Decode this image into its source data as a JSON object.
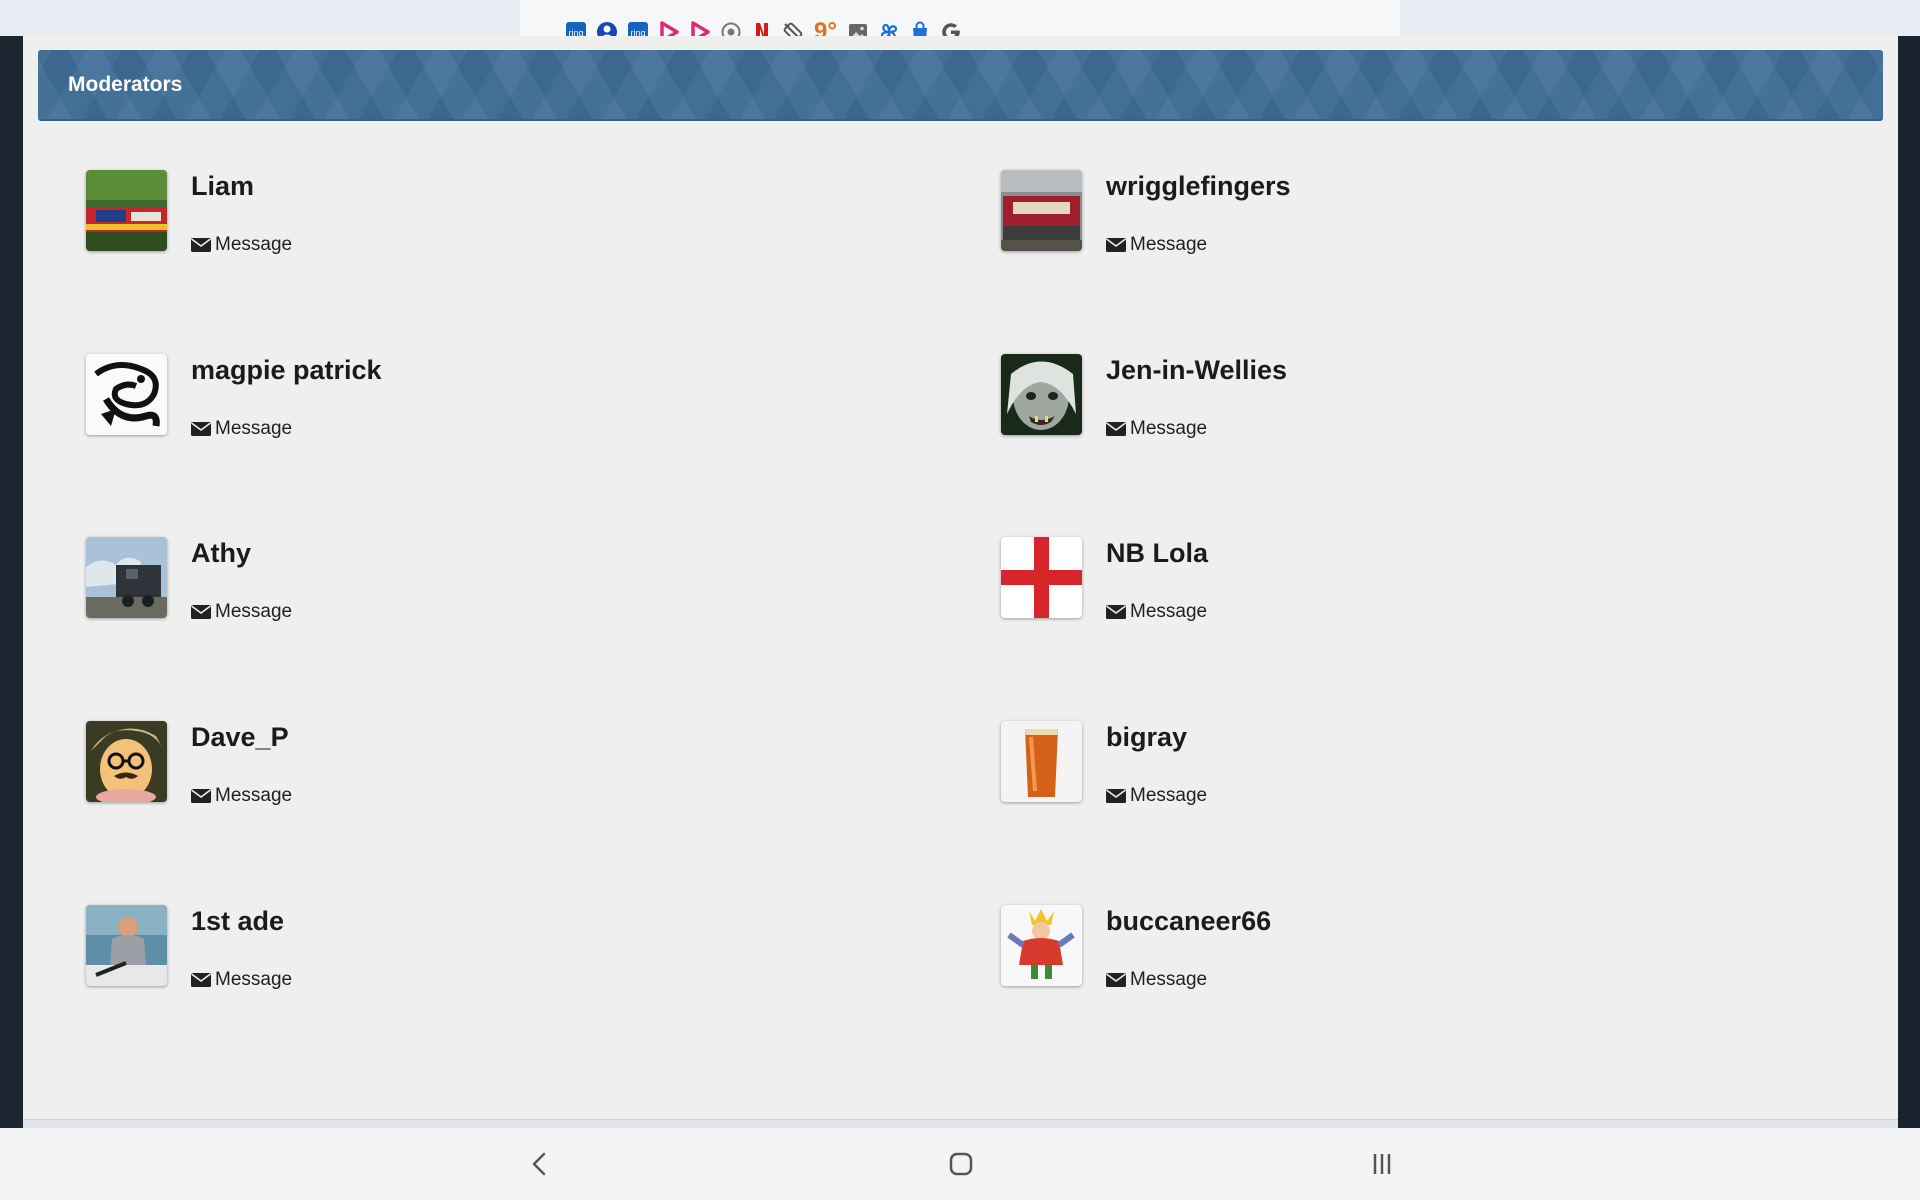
{
  "status_bar": {
    "icons": [
      "ring-icon",
      "account-icon",
      "ring-icon",
      "play-icon",
      "play-icon",
      "circle-check-icon",
      "netflix-icon",
      "rotate-icon",
      "weather-icon",
      "image-icon",
      "pinwheel-icon",
      "shopping-bag-icon",
      "google-icon"
    ],
    "temperature": "9°",
    "colors": {
      "blue": "#1565c0",
      "pink": "#e0287a",
      "red": "#d61a1a",
      "orange": "#e0701e",
      "gray": "#555555"
    }
  },
  "header": {
    "title": "Moderators",
    "color": "#3f6d97"
  },
  "members": [
    {
      "name": "Liam",
      "message_label": "Message",
      "avatar": "narrowboat-avatar"
    },
    {
      "name": "wrigglefingers",
      "message_label": "Message",
      "avatar": "boat-sign-avatar"
    },
    {
      "name": "magpie patrick",
      "message_label": "Message",
      "avatar": "magpie-drawing-avatar"
    },
    {
      "name": "Jen-in-Wellies",
      "message_label": "Message",
      "avatar": "monster-face-avatar"
    },
    {
      "name": "Athy",
      "message_label": "Message",
      "avatar": "steam-train-avatar"
    },
    {
      "name": "NB Lola",
      "message_label": "Message",
      "avatar": "st-george-cross-avatar"
    },
    {
      "name": "Dave_P",
      "message_label": "Message",
      "avatar": "disguise-glasses-avatar"
    },
    {
      "name": "bigray",
      "message_label": "Message",
      "avatar": "pint-glass-avatar"
    },
    {
      "name": "1st ade",
      "message_label": "Message",
      "avatar": "man-in-boat-avatar"
    },
    {
      "name": "buccaneer66",
      "message_label": "Message",
      "avatar": "cartoon-character-avatar"
    }
  ],
  "nav": {
    "buttons": [
      "back-icon",
      "home-icon",
      "recents-icon"
    ]
  }
}
